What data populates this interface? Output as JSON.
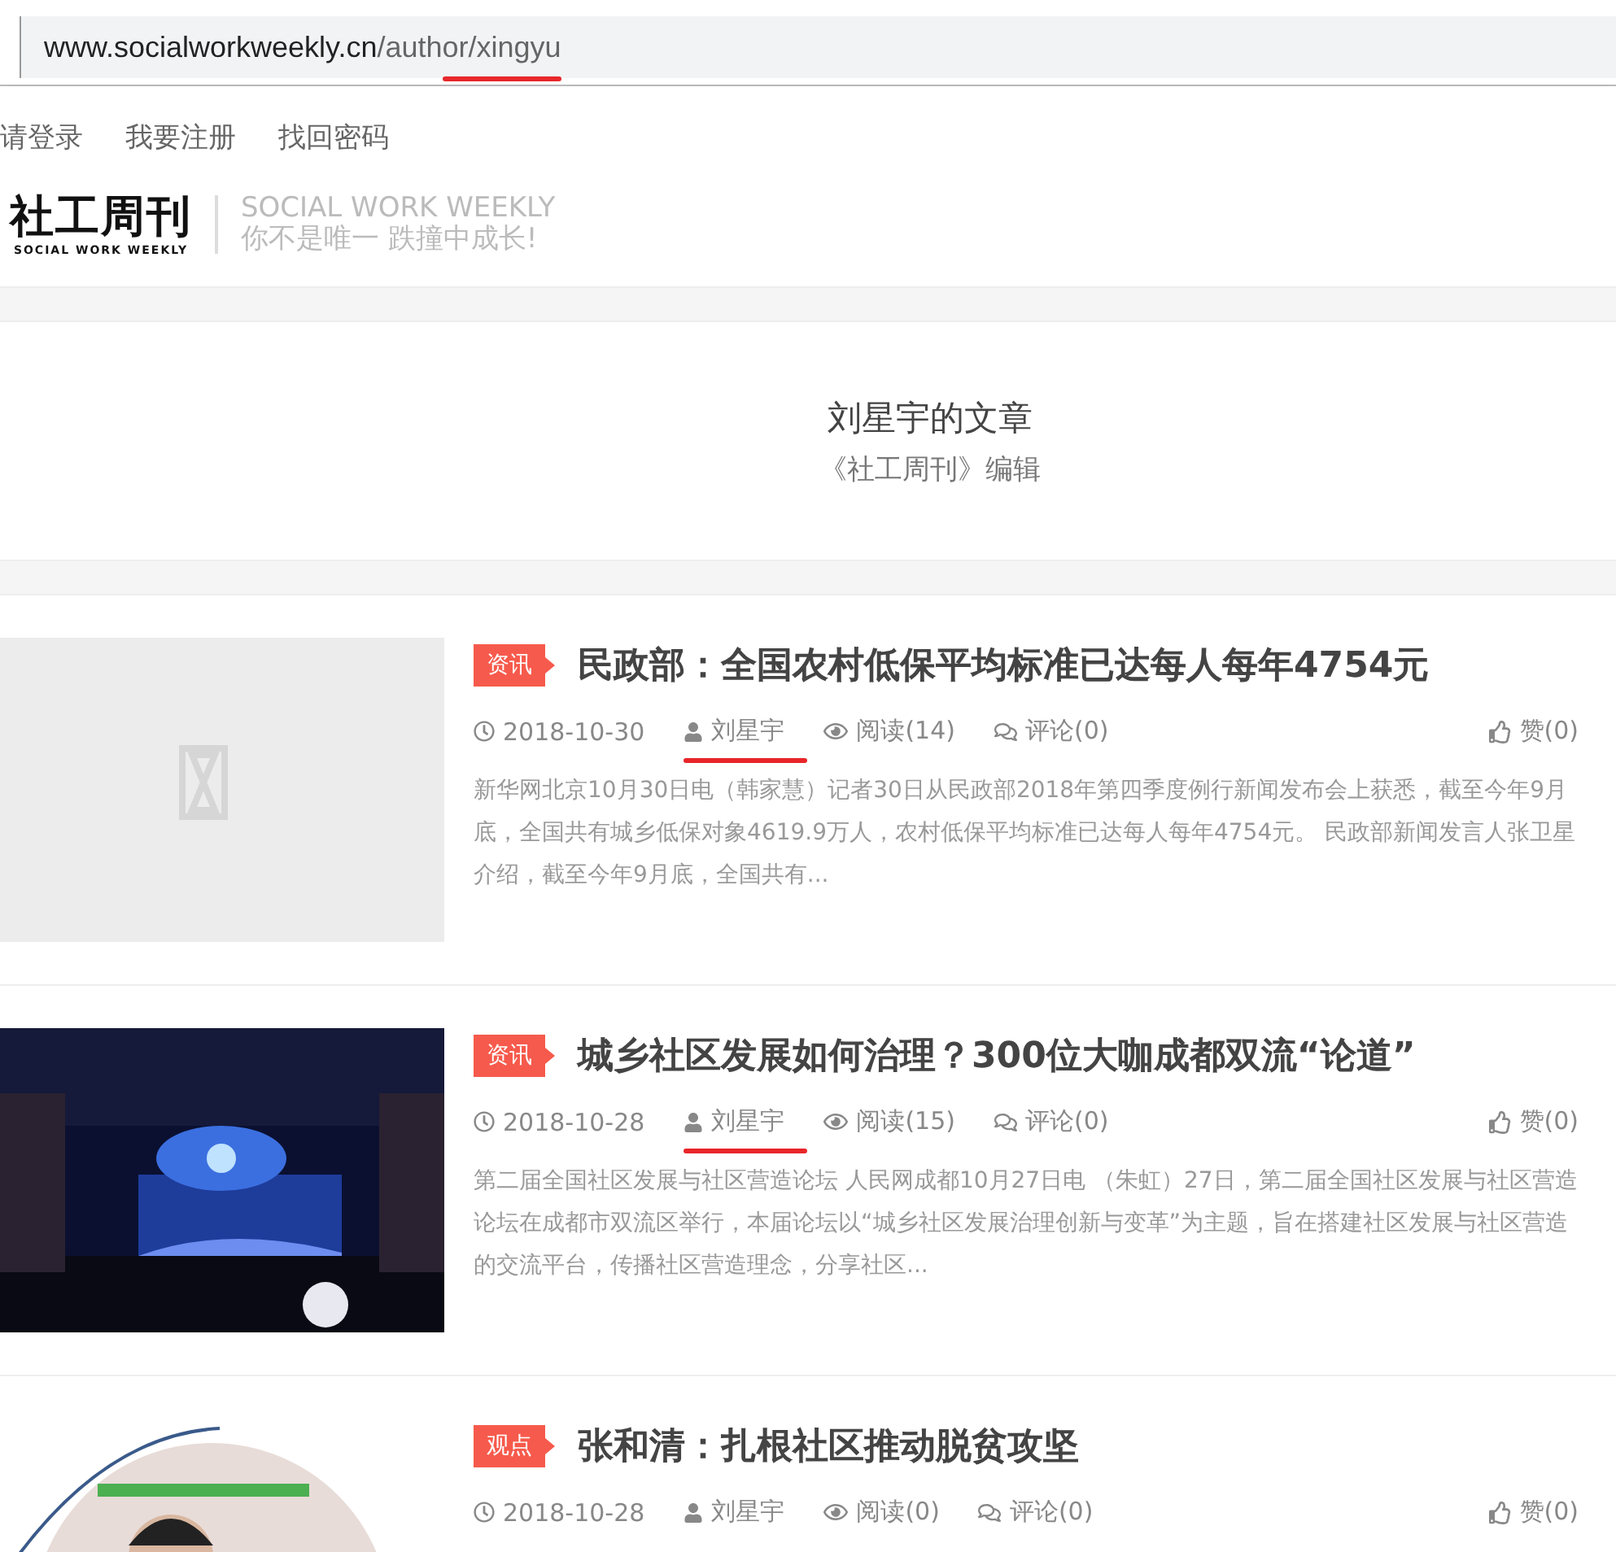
{
  "address_bar": {
    "host": "www.socialworkweekly.cn",
    "path": "/author/xingyu",
    "path_marked": true
  },
  "top_links": [
    "请登录",
    "我要注册",
    "找回密码"
  ],
  "logo": {
    "name": "社工周刊",
    "subtitle": "SOCIAL WORK WEEKLY",
    "slogan_en": "SOCIAL WORK WEEKLY",
    "slogan_cn": "你不是唯一 跌撞中成长!"
  },
  "author_header": {
    "title": "刘星宇的文章",
    "role": "《社工周刊》编辑"
  },
  "articles": [
    {
      "tag": "资讯",
      "title": "民政部：全国农村低保平均标准已达每人每年4754元",
      "date": "2018-10-30",
      "author": "刘星宇",
      "author_marked": true,
      "views": "阅读(14)",
      "comments": "评论(0)",
      "likes": "赞(0)",
      "excerpt": "新华网北京10月30日电（韩家慧）记者30日从民政部2018年第四季度例行新闻发布会上获悉，截至今年9月底，全国共有城乡低保对象4619.9万人，农村低保平均标准已达每人每年4754元。 民政部新闻发言人张卫星介绍，截至今年9月底，全国共有..."
    },
    {
      "tag": "资讯",
      "title": "城乡社区发展如何治理？300位大咖成都双流“论道”",
      "date": "2018-10-28",
      "author": "刘星宇",
      "author_marked": true,
      "views": "阅读(15)",
      "comments": "评论(0)",
      "likes": "赞(0)",
      "excerpt": "第二届全国社区发展与社区营造论坛 人民网成都10月27日电  （朱虹）27日，第二届全国社区发展与社区营造论坛在成都市双流区举行，本届论坛以“城乡社区发展治理创新与变革”为主题，旨在搭建社区发展与社区营造的交流平台，传播社区营造理念，分享社区..."
    },
    {
      "tag": "观点",
      "title": "张和清：扎根社区推动脱贫攻坚",
      "date": "2018-10-28",
      "author": "刘星宇",
      "author_marked": false,
      "views": "阅读(0)",
      "comments": "评论(0)",
      "likes": "赞(0)"
    }
  ]
}
